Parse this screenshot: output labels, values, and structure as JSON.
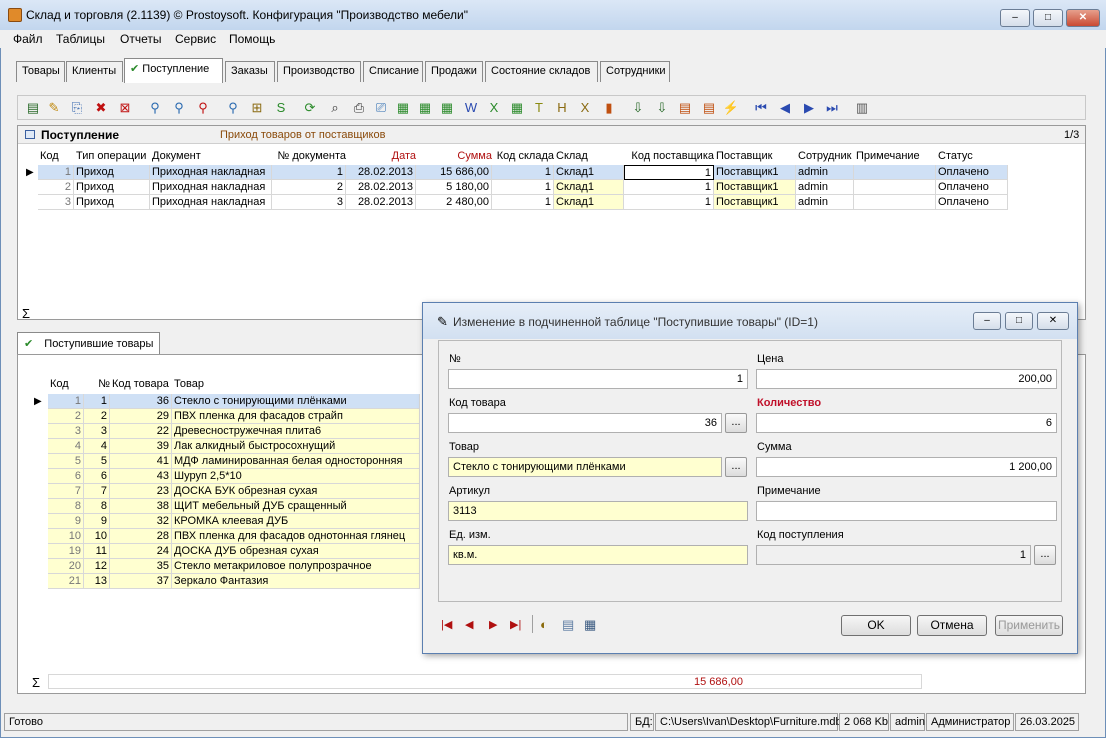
{
  "window": {
    "title": "Склад и торговля (2.1139) © Prostoysoft. Конфигурация \"Производство мебели\"",
    "min": "–",
    "max": "□",
    "close": "✕"
  },
  "menu": [
    "Файл",
    "Таблицы",
    "Отчеты",
    "Сервис",
    "Помощь"
  ],
  "tabs": [
    "Товары",
    "Клиенты",
    "Поступление",
    "Заказы",
    "Производство",
    "Списание",
    "Продажи",
    "Состояние складов",
    "Сотрудники"
  ],
  "active_tab_check": "✔",
  "toolbar_icons": [
    "new-record-icon",
    "edit-icon",
    "copy-icon",
    "delete-icon",
    "delete-all-icon",
    "filter-icon",
    "filter-add-icon",
    "filter-clear-icon",
    "sort-icon",
    "group-icon",
    "sql-icon",
    "refresh-icon",
    "find-icon",
    "print-icon",
    "preview-icon",
    "export-icon",
    "export2-icon",
    "export3-icon",
    "word-icon",
    "excel-icon",
    "export4-icon",
    "text-icon",
    "html-icon",
    "xml-icon",
    "chart-icon",
    "import-icon",
    "import2-icon",
    "report-icon",
    "report2-icon",
    "lightning-icon",
    "first-icon",
    "prev-icon",
    "next-icon",
    "last-icon",
    "calc-icon"
  ],
  "toolbar_glyphs": [
    "▤",
    "✎",
    "⎘",
    "✖",
    "⊠",
    "⚲",
    "⚲",
    "⚲",
    "⚲",
    "⊞",
    "S",
    "⟳",
    "⌕",
    "⎙",
    "⎚",
    "▦",
    "▦",
    "▦",
    "W",
    "X",
    "▦",
    "T",
    "H",
    "X",
    "▮",
    "⇩",
    "⇩",
    "▤",
    "▤",
    "⚡",
    "⏮",
    "◀",
    "▶",
    "⏭",
    "▥"
  ],
  "purchases": {
    "panel_title": "Поступление",
    "panel_subtitle": "Приход товаров от поставщиков",
    "counter": "1/3",
    "columns": [
      "Код",
      "Тип операции",
      "Документ",
      "№ документа",
      "Дата",
      "Сумма",
      "Код склада",
      "Склад",
      "Код поставщика",
      "Поставщик",
      "Сотрудник",
      "Примечание",
      "Статус"
    ],
    "rows": [
      [
        "1",
        "Приход",
        "Приходная накладная",
        "1",
        "28.02.2013",
        "15 686,00",
        "1",
        "Склад1",
        "1",
        "Поставщик1",
        "admin",
        "",
        "Оплачено"
      ],
      [
        "2",
        "Приход",
        "Приходная накладная",
        "2",
        "28.02.2013",
        "5 180,00",
        "1",
        "Склад1",
        "1",
        "Поставщик1",
        "admin",
        "",
        "Оплачено"
      ],
      [
        "3",
        "Приход",
        "Приходная накладная",
        "3",
        "28.02.2013",
        "2 480,00",
        "1",
        "Склад1",
        "1",
        "Поставщик1",
        "admin",
        "",
        "Оплачено"
      ]
    ],
    "sigma": "Σ"
  },
  "items": {
    "tab_label": "Поступившие товары",
    "columns": [
      "Код",
      "№",
      "Код товара",
      "Товар"
    ],
    "rows": [
      [
        "1",
        "1",
        "36",
        "Стекло с тонирующими плёнками"
      ],
      [
        "2",
        "2",
        "29",
        "ПВХ пленка для фасадов страйп"
      ],
      [
        "3",
        "3",
        "22",
        "Древесностружечная плита6"
      ],
      [
        "4",
        "4",
        "39",
        "Лак алкидный быстросохнущий"
      ],
      [
        "5",
        "5",
        "41",
        "МДФ ламинированная белая односторонняя"
      ],
      [
        "6",
        "6",
        "43",
        "Шуруп 2,5*10"
      ],
      [
        "7",
        "7",
        "23",
        "ДОСКА БУК обрезная сухая"
      ],
      [
        "8",
        "8",
        "38",
        "ЩИТ мебельный ДУБ сращенный"
      ],
      [
        "9",
        "9",
        "32",
        "КРОМКА клеевая ДУБ"
      ],
      [
        "10",
        "10",
        "28",
        "ПВХ пленка для фасадов однотонная глянец"
      ],
      [
        "19",
        "11",
        "24",
        "ДОСКА ДУБ обрезная сухая"
      ],
      [
        "20",
        "12",
        "35",
        "Стекло метакриловое полупрозрачное"
      ],
      [
        "21",
        "13",
        "37",
        "Зеркало Фантазия"
      ]
    ],
    "sigma": "Σ",
    "total": "15 686,00"
  },
  "dialog": {
    "title": "Изменение в подчиненной таблице \"Поступившие товары\" (ID=1)",
    "fields": {
      "num_label": "№",
      "num_value": "1",
      "price_label": "Цена",
      "price_value": "200,00",
      "code_label": "Код товара",
      "code_value": "36",
      "qty_label": "Количество",
      "qty_value": "6",
      "product_label": "Товар",
      "product_value": "Стекло с тонирующими плёнками",
      "sum_label": "Сумма",
      "sum_value": "1 200,00",
      "article_label": "Артикул",
      "article_value": "3113",
      "note_label": "Примечание",
      "note_value": "",
      "unit_label": "Ед. изм.",
      "unit_value": "кв.м.",
      "receipt_label": "Код поступления",
      "receipt_value": "1"
    },
    "ellipsis": "...",
    "nav": [
      "|◀",
      "◀",
      "▶",
      "▶|"
    ],
    "ok": "OK",
    "cancel": "Отмена",
    "apply": "Применить",
    "qty_color": "#c0102a"
  },
  "statusbar": {
    "ready": "Готово",
    "db_label": "БД:",
    "db_path": "C:\\Users\\Ivan\\Desktop\\Furniture.mdb",
    "size": "2 068 Kb",
    "user": "admin",
    "role": "Администратор",
    "date": "26.03.2025"
  }
}
